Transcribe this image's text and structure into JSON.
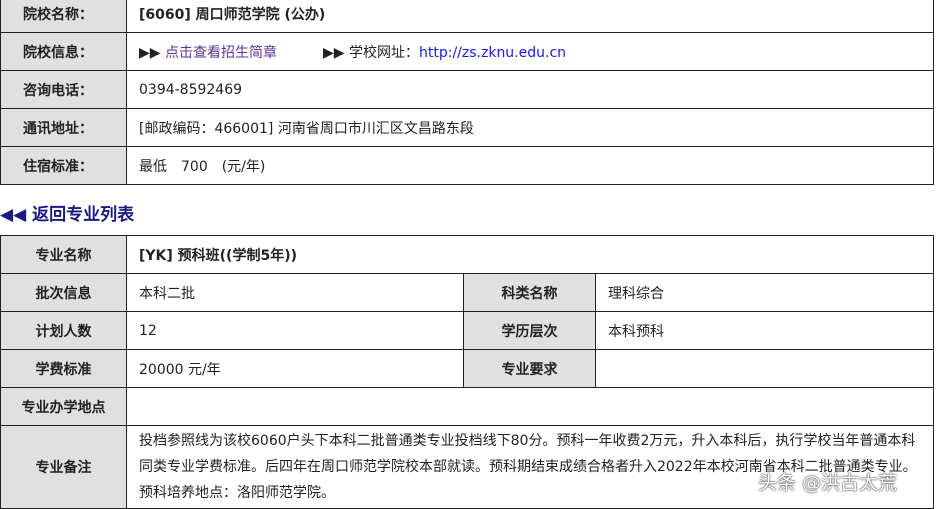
{
  "school": {
    "name_label": "院校名称：",
    "name": "[6060] 周口师范学院 (公办)",
    "info_label": "院校信息：",
    "arrows": "▶▶",
    "brochure_link": "点击查看招生简章",
    "site_label": "学校网址：",
    "site_url": "http://zs.zknu.edu.cn",
    "phone_label": "咨询电话：",
    "phone": "0394-8592469",
    "address_label": "通讯地址：",
    "address": "[邮政编码：466001] 河南省周口市川汇区文昌路东段",
    "dorm_label": "住宿标准：",
    "dorm": "最低　700　(元/年)"
  },
  "back_link": "◀◀ 返回专业列表",
  "major": {
    "name_label": "专业名称",
    "name": "[YK] 预科班((学制5年))",
    "batch_label": "批次信息",
    "batch": "本科二批",
    "subject_label": "科类名称",
    "subject": "理科综合",
    "plan_label": "计划人数",
    "plan": "12",
    "level_label": "学历层次",
    "level": "本科预科",
    "fee_label": "学费标准",
    "fee": "20000 元/年",
    "req_label": "专业要求",
    "req": "",
    "location_label": "专业办学地点",
    "location": "",
    "remark_label": "专业备注",
    "remark": "投档参照线为该校6060户头下本科二批普通类专业投档线下80分。预科一年收费2万元，升入本科后，执行学校当年普通本科同类专业学费标准。后四年在周口师范学院校本部就读。预科期结束成绩合格者升入2022年本校河南省本科二批普通类专业。预科培养地点：洛阳师范学院。"
  },
  "watermark": "头条 @洪古太荒"
}
